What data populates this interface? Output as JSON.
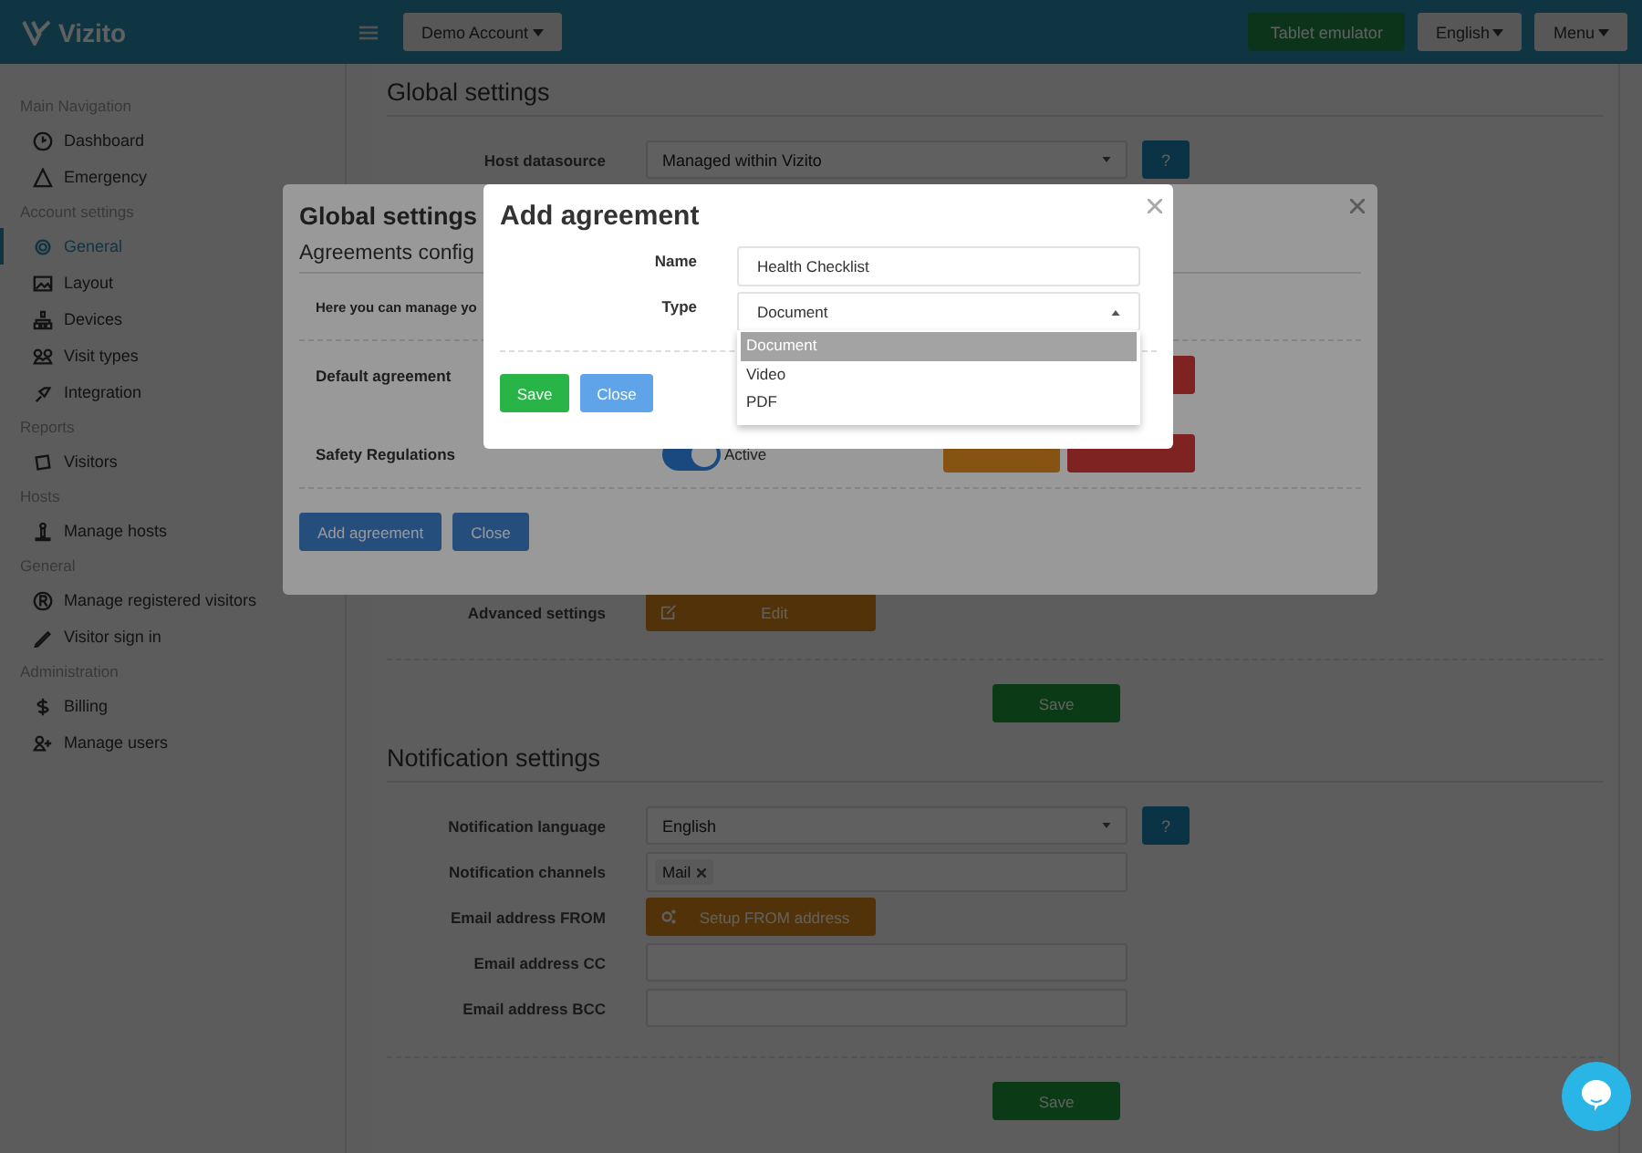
{
  "topbar": {
    "brand": "Vizito",
    "account_button": "Demo Account",
    "tablet_button": "Tablet emulator",
    "language_button": "English",
    "menu_button": "Menu"
  },
  "sidebar": {
    "sections": [
      {
        "header": "Main Navigation",
        "items": [
          {
            "label": "Dashboard",
            "selected": false
          },
          {
            "label": "Emergency",
            "selected": false
          }
        ]
      },
      {
        "header": "Account settings",
        "items": [
          {
            "label": "General",
            "selected": true
          },
          {
            "label": "Layout",
            "selected": false
          },
          {
            "label": "Devices",
            "selected": false
          },
          {
            "label": "Visit types",
            "selected": false
          },
          {
            "label": "Integration",
            "selected": false
          }
        ]
      },
      {
        "header": "Reports",
        "items": [
          {
            "label": "Visitors",
            "selected": false
          }
        ]
      },
      {
        "header": "Hosts",
        "items": [
          {
            "label": "Manage hosts",
            "selected": false
          }
        ]
      },
      {
        "header": "General",
        "items": [
          {
            "label": "Manage registered visitors",
            "selected": false
          },
          {
            "label": "Visitor sign in",
            "selected": false
          }
        ]
      },
      {
        "header": "Administration",
        "items": [
          {
            "label": "Billing",
            "selected": false
          },
          {
            "label": "Manage users",
            "selected": false
          }
        ]
      }
    ]
  },
  "global_settings": {
    "title": "Global settings",
    "host_datasource": {
      "label": "Host datasource",
      "value": "Managed within Vizito",
      "help": "?"
    },
    "advanced": {
      "label": "Advanced settings",
      "button": "Edit"
    },
    "save": "Save"
  },
  "notification_settings": {
    "title": "Notification settings",
    "language": {
      "label": "Notification language",
      "value": "English",
      "help": "?"
    },
    "channels": {
      "label": "Notification channels",
      "tags": [
        {
          "label": "Mail"
        }
      ]
    },
    "from": {
      "label": "Email address FROM",
      "button": "Setup FROM address"
    },
    "cc": {
      "label": "Email address CC"
    },
    "bcc": {
      "label": "Email address BCC"
    },
    "save": "Save"
  },
  "global_modal": {
    "title": "Global settings",
    "subtitle": "Agreements config",
    "intro": "Here you can manage yo",
    "agreements": [
      {
        "name": "Default agreement"
      },
      {
        "name": "Safety Regulations",
        "on": true,
        "status": "Active"
      }
    ],
    "add_button": "Add agreement",
    "close_button": "Close"
  },
  "add_modal": {
    "title": "Add agreement",
    "name": {
      "label": "Name",
      "value": "Health Checklist"
    },
    "type": {
      "label": "Type",
      "value": "Document",
      "options": [
        {
          "label": "Document",
          "selected": true
        },
        {
          "label": "Video",
          "selected": false
        },
        {
          "label": "PDF",
          "selected": false
        }
      ]
    },
    "save_button": "Save",
    "close_button": "Close"
  }
}
